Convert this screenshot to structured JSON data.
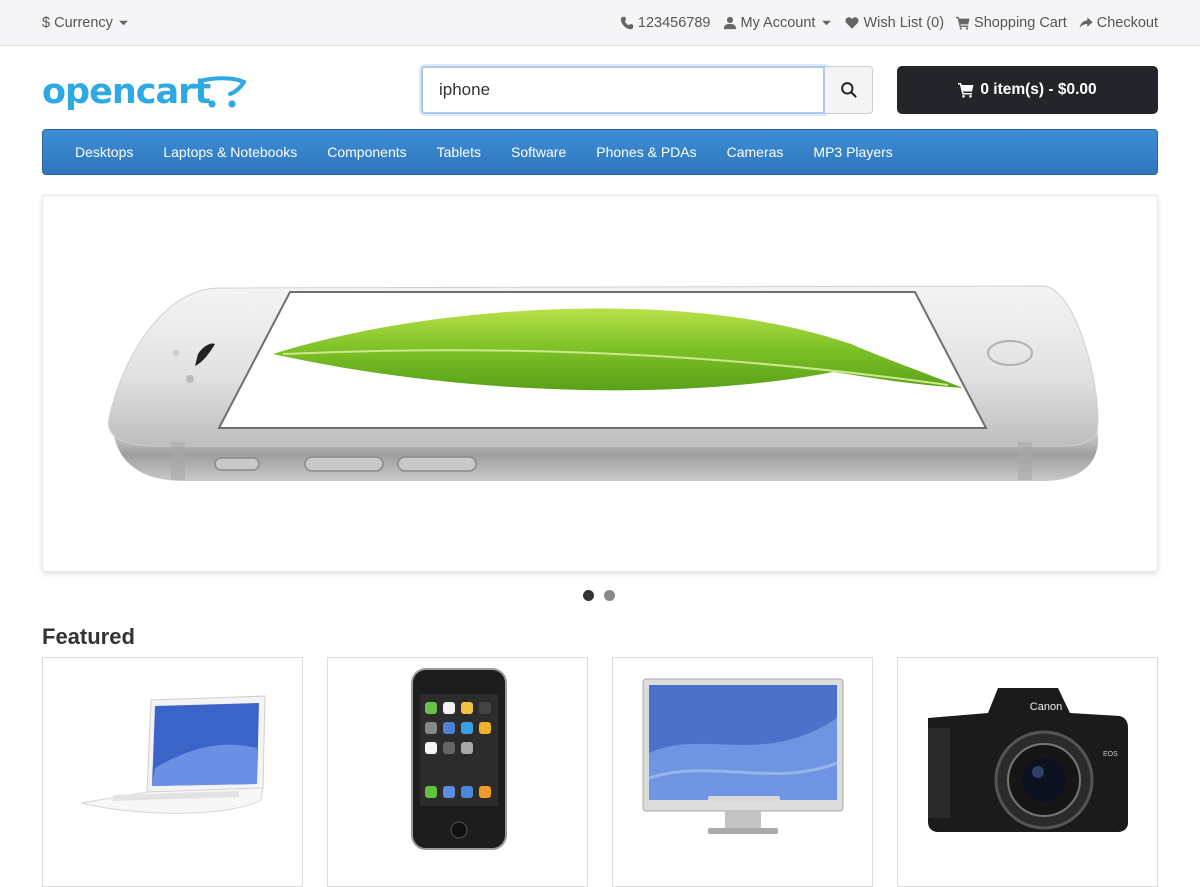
{
  "topbar": {
    "currency_label": "$ Currency",
    "phone": "123456789",
    "my_account": "My Account",
    "wish_list": "Wish List (0)",
    "shopping_cart": "Shopping Cart",
    "checkout": "Checkout"
  },
  "header": {
    "logo_text": "opencart",
    "search_value": "iphone",
    "cart_label": "0 item(s) - $0.00"
  },
  "nav": {
    "items": [
      "Desktops",
      "Laptops & Notebooks",
      "Components",
      "Tablets",
      "Software",
      "Phones & PDAs",
      "Cameras",
      "MP3 Players"
    ]
  },
  "slideshow": {
    "slide_count": 2,
    "active_index": 0
  },
  "featured": {
    "title": "Featured",
    "products": [
      "laptop-image",
      "iphone-image",
      "monitor-image",
      "camera-image"
    ]
  },
  "colors": {
    "accent": "#2da9e3",
    "nav_blue": "#3784cb",
    "cart_button": "#222529"
  }
}
